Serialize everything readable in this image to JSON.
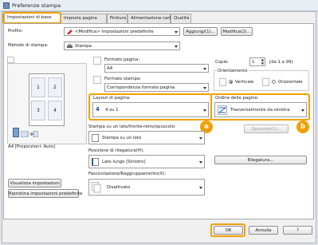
{
  "window": {
    "title": "Preferenze stampa"
  },
  "tabs": [
    {
      "label": "Impostazioni di base"
    },
    {
      "label": "Imposta pagina"
    },
    {
      "label": "Finitura"
    },
    {
      "label": "Alimentazione carta"
    },
    {
      "label": "Qualità"
    }
  ],
  "profile": {
    "label": "Profilo:",
    "value": "<Modifica> Impostazioni predefinite",
    "add_label": "Aggiungi(1)...",
    "edit_label": "Modifica(2)..."
  },
  "output_method": {
    "label": "Metodo di stampa:",
    "value": "Stampa"
  },
  "preview": {
    "caption": "A4 [Proporzioni: Auto]",
    "view_settings_label": "Visualizza impostazioni",
    "restore_defaults_label": "Ripristina impostazioni predefinite",
    "page_numbers": [
      "1",
      "2",
      "3",
      "4"
    ]
  },
  "page_size": {
    "label": "Formato pagina:",
    "value": "A4"
  },
  "output_size": {
    "label": "Formato stampa:",
    "value": "Corrispondenza formato pagina"
  },
  "copies": {
    "label": "Copie:",
    "value": "1",
    "range": "[da 1 a 99]"
  },
  "orientation": {
    "label": "Orientamento",
    "portrait": "Verticale",
    "landscape": "Orizzontale",
    "selected": "Verticale"
  },
  "page_layout": {
    "label": "Layout di pagina:",
    "value": "4 su 1",
    "icon_number": "4"
  },
  "page_order": {
    "label": "Ordine delle pagine:",
    "value": "Trasversalmente da sinistra"
  },
  "print_style": {
    "label": "Stampa su un lato/fronte-retro/opuscolo:",
    "value": "Stampa su un lato",
    "booklet_label": "Opuscolo(1)..."
  },
  "binding": {
    "label": "Posizione di rilegatura(H):",
    "value": "Lato lungo [Sinistro]",
    "gutter_label": "Rilegatura..."
  },
  "collate": {
    "label": "Fascicolazione/Raggruppamento(X):",
    "value": "Disattivato"
  },
  "callouts": {
    "a": "a",
    "b": "b"
  },
  "footer": {
    "ok": "OK",
    "cancel": "Annulla",
    "help": "?"
  },
  "colors": {
    "accent": "#f0a000"
  }
}
